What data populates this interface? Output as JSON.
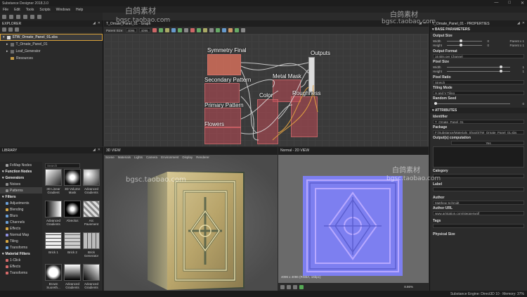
{
  "window": {
    "title": "Substance Designer 2018.3.0"
  },
  "menu": [
    "File",
    "Edit",
    "Tools",
    "Scripts",
    "Windows",
    "Help"
  ],
  "explorer": {
    "title": "EXPLORER",
    "items": [
      {
        "label": "STW_Ornate_Panel_01.sbs"
      },
      {
        "label": "T_Ornate_Panel_01"
      },
      {
        "label": "Leaf_Generator"
      },
      {
        "label": "Resources"
      }
    ]
  },
  "graph": {
    "title": "T_Ornate_Panel_01 - Graph",
    "parent_size_label": "Parent Size:",
    "parent_size_w": "4096",
    "parent_size_h": "4096",
    "groups": [
      {
        "label": "Symmetry Final"
      },
      {
        "label": "Outputs"
      },
      {
        "label": "Secondary Pattern"
      },
      {
        "label": "Metal Mask"
      },
      {
        "label": "Primary Pattern"
      },
      {
        "label": "Color"
      },
      {
        "label": "Roughness"
      },
      {
        "label": "Flowers"
      }
    ]
  },
  "properties": {
    "title": "T_Ornate_Panel_01 - PROPERTIES",
    "base_section": "BASE PARAMETERS",
    "output_size": {
      "label": "Output Size",
      "width_label": "Width",
      "height_label": "Height",
      "width_val": "0",
      "height_val": "0",
      "width_mode": "Parent x 1",
      "height_mode": "Parent x 1"
    },
    "output_format": {
      "label": "Output Format",
      "value": "16 Bits per Channel"
    },
    "pixel_size": {
      "label": "Pixel Size",
      "width_label": "Width",
      "height_label": "Height",
      "width_val": "1",
      "height_val": "1"
    },
    "pixel_ratio": {
      "label": "Pixel Ratio",
      "value": "Stretch"
    },
    "tiling": {
      "label": "Tiling Mode",
      "value": "H and V Tiling"
    },
    "seed": {
      "label": "Random Seed",
      "value": "0"
    },
    "attributes_section": "ATTRIBUTES",
    "identifier": {
      "label": "Identifier",
      "value": "T_Ornate_Panel_01"
    },
    "package": {
      "label": "Package",
      "value": "F:/Substance/Materials_Shop/STW_Ornate_Panel_01.sbs"
    },
    "output_comp": {
      "label": "Output(s) computation",
      "value": "Yes"
    },
    "category": {
      "label": "Category"
    },
    "label": {
      "label": "Label"
    },
    "author": {
      "label": "Author",
      "value": "Matthew Schmidt"
    },
    "author_url": {
      "label": "Author URL",
      "value": "www.artstation.com/stepperwolf"
    },
    "tags": {
      "label": "Tags"
    },
    "physical_size": {
      "label": "Physical Size"
    }
  },
  "library": {
    "title": "LIBRARY",
    "search_placeholder": "Search",
    "categories": [
      {
        "label": "FxMap Nodes",
        "type": "item",
        "color": "#a0a0a0"
      },
      {
        "label": "Function Nodes",
        "type": "head",
        "color": "#c0c0c0"
      },
      {
        "label": "Generators",
        "type": "head",
        "color": "#c0c0c0"
      },
      {
        "label": "Noises",
        "type": "item",
        "color": "#8d8d8d"
      },
      {
        "label": "Patterns",
        "type": "active",
        "color": "#8d8d8d"
      },
      {
        "label": "Filters",
        "type": "head",
        "color": "#c0c0c0"
      },
      {
        "label": "Adjustments",
        "type": "item",
        "color": "#6a9fd8"
      },
      {
        "label": "Blending",
        "type": "item",
        "color": "#d6a742"
      },
      {
        "label": "Blurs",
        "type": "item",
        "color": "#6a9fd8"
      },
      {
        "label": "Channels",
        "type": "item",
        "color": "#6a9fd8"
      },
      {
        "label": "Effects",
        "type": "item",
        "color": "#d6a742"
      },
      {
        "label": "Normal Map",
        "type": "item",
        "color": "#8f8fe0"
      },
      {
        "label": "Tiling",
        "type": "item",
        "color": "#d6a742"
      },
      {
        "label": "Transforms",
        "type": "item",
        "color": "#6a9fd8"
      },
      {
        "label": "Material Filters",
        "type": "head",
        "color": "#c0c0c0"
      },
      {
        "label": "1-Click",
        "type": "item",
        "color": "#d66a6a"
      },
      {
        "label": "Effects",
        "type": "item",
        "color": "#d66a6a"
      },
      {
        "label": "Transforms",
        "type": "item",
        "color": "#d66a6a"
      }
    ],
    "thumbs": [
      {
        "label": "3D Linear Gradient"
      },
      {
        "label": "3D Volume Mask"
      },
      {
        "label": "Advanced Gradients"
      },
      {
        "label": "Advanced Gradients"
      },
      {
        "label": "Alveolus"
      },
      {
        "label": "Arc Pavement"
      },
      {
        "label": "Brick 1"
      },
      {
        "label": "Brick 2"
      },
      {
        "label": "Brick Generator"
      },
      {
        "label": "Brown Suoreth..."
      },
      {
        "label": "Advanced Gradients"
      },
      {
        "label": "Advanced Gradients"
      }
    ]
  },
  "view3d": {
    "title": "3D VIEW",
    "menu": [
      "Scene",
      "Materials",
      "Lights",
      "Camera",
      "Environment",
      "Display",
      "Renderer"
    ]
  },
  "view2d": {
    "title": "Normal - 2D VIEW",
    "size_info": "4096 x 4096 (RGBA, 16bpc)",
    "zoom": "8.86%"
  },
  "status": {
    "text": "Substance Engine: Direct3D 10 · Memory: 37%"
  },
  "watermarks": [
    "白鸽素材",
    "bgsc.taobao.com"
  ]
}
